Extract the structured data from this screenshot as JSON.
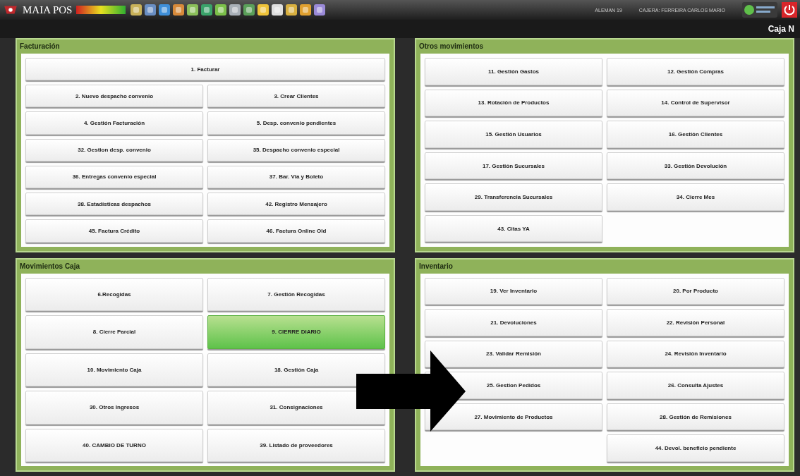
{
  "topbar": {
    "app_name": "MAIA POS",
    "user": "ALEMAN 19",
    "cashier": "CAJERA: FERREIRA CARLOS MARIO"
  },
  "subbar": {
    "title": "Caja N"
  },
  "panels": [
    {
      "title": "Facturación",
      "items": [
        {
          "label": "1. Facturar",
          "kind": "wide",
          "selected": false
        },
        {
          "label": "2. Nuevo despacho convenio",
          "kind": "normal",
          "selected": false
        },
        {
          "label": "3. Crear Clientes",
          "kind": "normal",
          "selected": false
        },
        {
          "label": "4. Gestión Facturación",
          "kind": "normal",
          "selected": false
        },
        {
          "label": "5. Desp. convenio pendientes",
          "kind": "normal",
          "selected": false
        },
        {
          "label": "32. Gestion desp. convenio",
          "kind": "normal",
          "selected": false
        },
        {
          "label": "35. Despacho convenio especial",
          "kind": "normal",
          "selected": false
        },
        {
          "label": "36. Entregas convenio especial",
          "kind": "normal",
          "selected": false
        },
        {
          "label": "37. Bar. Via y Boleto",
          "kind": "normal",
          "selected": false
        },
        {
          "label": "38. Estadísticas despachos",
          "kind": "normal",
          "selected": false
        },
        {
          "label": "42. Registro Mensajero",
          "kind": "normal",
          "selected": false
        },
        {
          "label": "45. Factura Crédito",
          "kind": "normal",
          "selected": false
        },
        {
          "label": "46. Factura Online Old",
          "kind": "normal",
          "selected": false
        }
      ]
    },
    {
      "title": "Otros movimientos",
      "items": [
        {
          "label": "11. Gestión Gastos",
          "kind": "normal",
          "selected": false
        },
        {
          "label": "12. Gestión Compras",
          "kind": "normal",
          "selected": false
        },
        {
          "label": "13. Rotación de Productos",
          "kind": "normal",
          "selected": false
        },
        {
          "label": "14. Control de Supervisor",
          "kind": "normal",
          "selected": false
        },
        {
          "label": "15. Gestión Usuarios",
          "kind": "normal",
          "selected": false
        },
        {
          "label": "16. Gestión Clientes",
          "kind": "normal",
          "selected": false
        },
        {
          "label": "17. Gestión Sucursales",
          "kind": "normal",
          "selected": false
        },
        {
          "label": "33. Gestión Devolución",
          "kind": "normal",
          "selected": false
        },
        {
          "label": "29. Transferencia Sucursales",
          "kind": "normal",
          "selected": false
        },
        {
          "label": "34. Cierre Mes",
          "kind": "normal",
          "selected": false
        },
        {
          "label": "43. Citas YA",
          "kind": "normal",
          "selected": false
        }
      ]
    },
    {
      "title": "Movimientos Caja",
      "items": [
        {
          "label": "6.Recogidas",
          "kind": "normal",
          "selected": false
        },
        {
          "label": "7. Gestión Recogidas",
          "kind": "normal",
          "selected": false
        },
        {
          "label": "8. Cierre Parcial",
          "kind": "normal",
          "selected": false
        },
        {
          "label": "9. CIERRE DIARIO",
          "kind": "normal",
          "selected": true
        },
        {
          "label": "10. Movimiento Caja",
          "kind": "normal",
          "selected": false
        },
        {
          "label": "18. Gestión Caja",
          "kind": "normal",
          "selected": false
        },
        {
          "label": "30. Otros Ingresos",
          "kind": "normal",
          "selected": false
        },
        {
          "label": "31. Consignaciones",
          "kind": "normal",
          "selected": false
        },
        {
          "label": "40. CAMBIO DE TURNO",
          "kind": "normal",
          "selected": false
        },
        {
          "label": "39. Listado de proveedores",
          "kind": "normal",
          "selected": false
        }
      ]
    },
    {
      "title": "Inventario",
      "items": [
        {
          "label": "19. Ver Inventario",
          "kind": "normal",
          "selected": false
        },
        {
          "label": "20. Por Producto",
          "kind": "normal",
          "selected": false
        },
        {
          "label": "21. Devoluciones",
          "kind": "normal",
          "selected": false
        },
        {
          "label": "22. Revisión Personal",
          "kind": "normal",
          "selected": false
        },
        {
          "label": "23. Validar Remisión",
          "kind": "normal",
          "selected": false
        },
        {
          "label": "24. Revisión Inventario",
          "kind": "normal",
          "selected": false
        },
        {
          "label": "25. Gestion Pedidos",
          "kind": "normal",
          "selected": false
        },
        {
          "label": "26. Consulta Ajustes",
          "kind": "normal",
          "selected": false
        },
        {
          "label": "27. Movimiento de Productos",
          "kind": "normal",
          "selected": false
        },
        {
          "label": "28. Gestión de Remisiones",
          "kind": "normal",
          "selected": false
        },
        {
          "label": "44. Devol. beneficio pendiente",
          "kind": "right",
          "selected": false
        }
      ]
    }
  ]
}
